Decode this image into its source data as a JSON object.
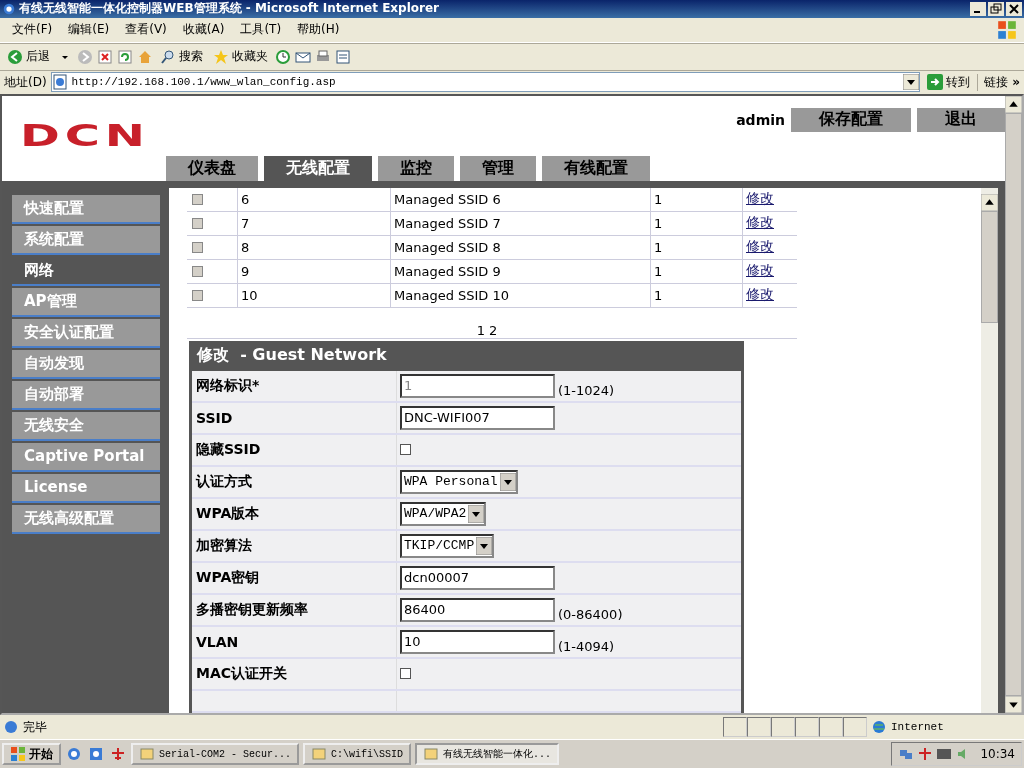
{
  "window": {
    "title": "有线无线智能一体化控制器WEB管理系统 - Microsoft Internet Explorer"
  },
  "menu": [
    "文件(F)",
    "编辑(E)",
    "查看(V)",
    "收藏(A)",
    "工具(T)",
    "帮助(H)"
  ],
  "toolbar": {
    "back": "后退",
    "search": "搜索",
    "favorites": "收藏夹"
  },
  "address": {
    "label": "地址(D)",
    "url": "http://192.168.100.1/www_wlan_config.asp",
    "go": "转到",
    "links": "链接",
    "more": "»"
  },
  "header": {
    "logo": "DCN",
    "user": "admin",
    "buttons": [
      "保存配置",
      "退出"
    ]
  },
  "tabs": [
    {
      "label": "仪表盘",
      "selected": false
    },
    {
      "label": "无线配置",
      "selected": true
    },
    {
      "label": "监控",
      "selected": false
    },
    {
      "label": "管理",
      "selected": false
    },
    {
      "label": "有线配置",
      "selected": false
    }
  ],
  "sidebar": [
    {
      "label": "快速配置",
      "selected": false
    },
    {
      "label": "系统配置",
      "selected": false
    },
    {
      "label": "网络",
      "selected": true
    },
    {
      "label": "AP管理",
      "selected": false
    },
    {
      "label": "安全认证配置",
      "selected": false
    },
    {
      "label": "自动发现",
      "selected": false
    },
    {
      "label": "自动部署",
      "selected": false
    },
    {
      "label": "无线安全",
      "selected": false
    },
    {
      "label": "Captive Portal",
      "selected": false
    },
    {
      "label": "License",
      "selected": false
    },
    {
      "label": "无线高级配置",
      "selected": false
    }
  ],
  "table": {
    "rows": [
      {
        "checked": false,
        "id": "6",
        "name": "Managed SSID 6",
        "column_4": "1",
        "action": "修改"
      },
      {
        "checked": false,
        "id": "7",
        "name": "Managed SSID 7",
        "column_4": "1",
        "action": "修改"
      },
      {
        "checked": false,
        "id": "8",
        "name": "Managed SSID 8",
        "column_4": "1",
        "action": "修改"
      },
      {
        "checked": false,
        "id": "9",
        "name": "Managed SSID 9",
        "column_4": "1",
        "action": "修改"
      },
      {
        "checked": false,
        "id": "10",
        "name": "Managed SSID 10",
        "column_4": "1",
        "action": "修改"
      }
    ],
    "pages": [
      "1",
      "2"
    ]
  },
  "form": {
    "title": "修改  - Guest Network",
    "fields": [
      {
        "kind": "text",
        "label": "网络标识*",
        "value": "1",
        "disabled": true,
        "hint": "(1-1024)"
      },
      {
        "kind": "text",
        "label": "SSID",
        "value": "DNC-WIFI007",
        "disabled": false
      },
      {
        "kind": "checkbox",
        "label": "隐藏SSID",
        "checked": false
      },
      {
        "kind": "select",
        "label": "认证方式",
        "value": "WPA Personal"
      },
      {
        "kind": "select",
        "label": "WPA版本",
        "value": "WPA/WPA2"
      },
      {
        "kind": "select",
        "label": "加密算法",
        "value": "TKIP/CCMP"
      },
      {
        "kind": "text",
        "label": "WPA密钥",
        "value": "dcn00007",
        "disabled": false
      },
      {
        "kind": "text",
        "label": "多播密钥更新频率",
        "value": "86400",
        "disabled": false,
        "hint": "(0-86400)"
      },
      {
        "kind": "text",
        "label": "VLAN",
        "value": "10",
        "disabled": false,
        "hint": "(1-4094)"
      },
      {
        "kind": "checkbox",
        "label": "MAC认证开关",
        "checked": false
      }
    ]
  },
  "status_bar": {
    "text": "完毕",
    "zone": "Internet"
  },
  "taskbar": {
    "start": "开始",
    "tasks": [
      {
        "label": "Serial-COM2 - Secur...",
        "selected": false
      },
      {
        "label": "C:\\wifi\\SSID",
        "selected": false
      },
      {
        "label": "有线无线智能一体化...",
        "selected": true
      }
    ],
    "clock": "10:34"
  }
}
